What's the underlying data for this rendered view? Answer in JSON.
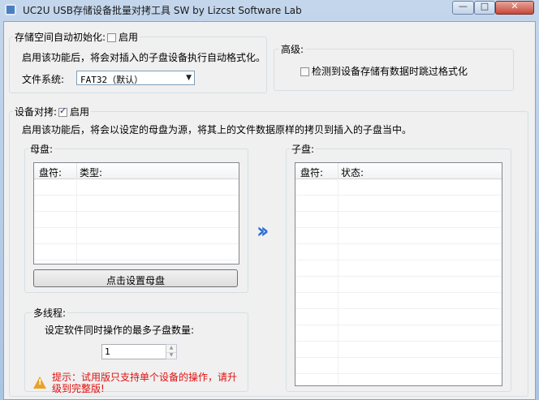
{
  "window": {
    "title": "UC2U USB存储设备批量对拷工具 SW  by Lizcst Software Lab",
    "controls": {
      "minimize": "—",
      "maximize": "□",
      "close": "✕"
    }
  },
  "storage_format": {
    "title": "存储空间自动初始化:",
    "enable_label": "启用",
    "enabled": false,
    "description": "启用该功能后，将会对插入的子盘设备执行自动格式化。",
    "filesystem_label": "文件系统:",
    "filesystem_value": "FAT32（默认）"
  },
  "advanced": {
    "title": "高级:",
    "skip_format_label": "检测到设备存储有数据时跳过格式化",
    "skip_format_checked": false
  },
  "device_copy": {
    "title": "设备对拷:",
    "enable_label": "启用",
    "enabled": true,
    "description": "启用该功能后，将会以设定的母盘为源，将其上的文件数据原样的拷贝到插入的子盘当中。"
  },
  "master_disk": {
    "title": "母盘:",
    "columns": [
      "盘符:",
      "类型:"
    ],
    "set_button": "点击设置母盘"
  },
  "child_disk": {
    "title": "子盘:",
    "columns": [
      "盘符:",
      "状态:"
    ]
  },
  "multithread": {
    "title": "多线程:",
    "max_label": "设定软件同时操作的最多子盘数量:",
    "max_value": "1"
  },
  "warning": {
    "text": "提示：试用版只支持单个设备的操作，请升级到完整版!"
  },
  "arrows_glyph": "››"
}
